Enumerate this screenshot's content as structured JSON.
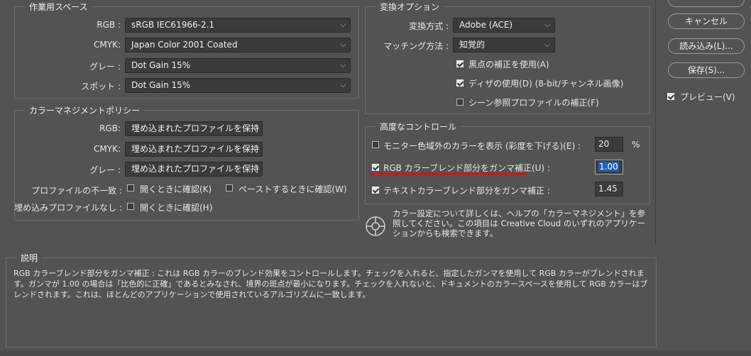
{
  "working_spaces": {
    "title": "作業用スペース",
    "rgb_label": "RGB :",
    "rgb_value": "sRGB IEC61966-2.1",
    "cmyk_label": "CMYK:",
    "cmyk_value": "Japan Color 2001 Coated",
    "gray_label": "グレー :",
    "gray_value": "Dot Gain 15%",
    "spot_label": "スポット :",
    "spot_value": "Dot Gain 15%"
  },
  "color_policies": {
    "title": "カラーマネジメントポリシー",
    "rgb_label": "RGB:",
    "rgb_value": "埋め込まれたプロファイルを保持",
    "cmyk_label": "CMYK:",
    "cmyk_value": "埋め込まれたプロファイルを保持",
    "gray_label": "グレー :",
    "gray_value": "埋め込まれたプロファイルを保持",
    "mismatch_label": "プロファイルの不一致 :",
    "ask_open": "開くときに確認(K)",
    "ask_paste": "ペーストするときに確認(W)",
    "missing_label": "埋め込みプロファイルなし :",
    "ask_open_missing": "開くときに確認(H)"
  },
  "conversion": {
    "title": "変換オプション",
    "engine_label": "変換方式 :",
    "engine_value": "Adobe (ACE)",
    "intent_label": "マッチング方法 :",
    "intent_value": "知覚的",
    "bpc": "黒点の補正を使用(A)",
    "dither": "ディザの使用(D) (8-bit/チャンネル画像)",
    "scene": "シーン参照プロファイルの補正(F)"
  },
  "advanced": {
    "title": "高度なコントロール",
    "desaturate": "モニター色域外のカラーを表示 (彩度を下げる)(E) :",
    "desaturate_value": "20",
    "percent": "%",
    "blend_rgb": "RGB カラーブレンド部分をガンマ補正(U) :",
    "blend_rgb_value": "1.00",
    "blend_text": "テキストカラーブレンド部分をガンマ補正 :",
    "blend_text_value": "1.45"
  },
  "info": "カラー設定について詳しくは、ヘルプの「カラーマネジメント」を参照してください。この項目は Creative Cloud のいずれのアプリケーションからも検索できます。",
  "description": {
    "title": "説明",
    "text": "RGB カラーブレンド部分をガンマ補正 : これは RGB カラーのブレンド効果をコントロールします。チェックを入れると、指定したガンマを使用して RGB カラーがブレンドされます。ガンマが 1.00 の場合は「比色的に正確」であるとみなされ、境界の斑点が最小になります。チェックを入れないと、ドキュメントのカラースペースを使用して RGB カラーはブレンドされます。これは、ほとんどのアプリケーションで使用されているアルゴリズムに一致します。"
  },
  "buttons": {
    "cancel": "キャンセル",
    "load": "読み込み(L)...",
    "save": "保存(S)...",
    "preview": "プレビュー(V)"
  }
}
